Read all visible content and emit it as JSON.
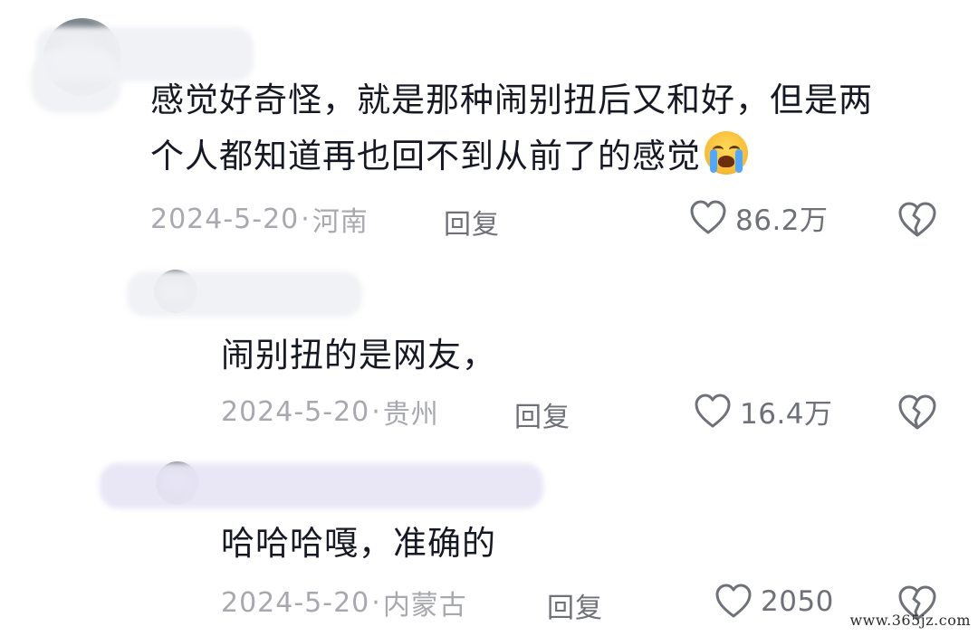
{
  "comments": [
    {
      "text_lines": [
        "感觉好奇怪，就是那种闹别扭后又和好，但是两",
        "个人都知道再也回不到从前了的感觉"
      ],
      "emoji": "loudly-crying-face",
      "date": "2024-5-20",
      "dot": "·",
      "location": "河南",
      "reply_label": "回复",
      "like_count": "86.2万"
    },
    {
      "text_lines": [
        "闹别扭的是网友，"
      ],
      "date": "2024-5-20",
      "dot": "·",
      "location": "贵州",
      "reply_label": "回复",
      "like_count": "16.4万"
    },
    {
      "text_lines": [
        "哈哈哈嘎，准确的"
      ],
      "date": "2024-5-20",
      "dot": "·",
      "location": "内蒙古",
      "reply_label": "回复",
      "like_count": "2050"
    }
  ],
  "icons": {
    "like": "heart-outline-icon",
    "dislike": "broken-heart-icon"
  },
  "colors": {
    "text": "#161823",
    "meta": "#a8a9ae",
    "action": "#6f7178"
  },
  "watermark": "www.365jz.com"
}
